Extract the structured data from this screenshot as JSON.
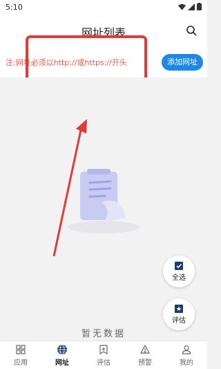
{
  "status_bar": {
    "time": "5:10"
  },
  "header": {
    "title": "网址列表"
  },
  "notice": {
    "text": "注:网址必须以http://或https://开头",
    "add_button": "添加网址"
  },
  "empty_state": {
    "text": "暂无数据"
  },
  "fabs": {
    "select_all": "全选",
    "evaluate": "评估"
  },
  "tabs": [
    {
      "label": "应用",
      "icon": "apps-icon"
    },
    {
      "label": "网址",
      "icon": "globe-icon",
      "active": true
    },
    {
      "label": "评估",
      "icon": "bookmark-star-icon"
    },
    {
      "label": "预警",
      "icon": "warning-icon"
    },
    {
      "label": "我的",
      "icon": "person-icon"
    }
  ],
  "colors": {
    "accent": "#1e88e5",
    "notice": "#ff5a4a",
    "annotation": "#e53935"
  }
}
